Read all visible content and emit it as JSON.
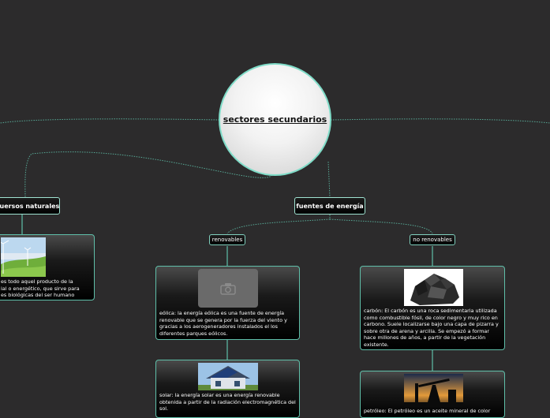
{
  "central_topic": "sectores secundarios",
  "topics": {
    "recursos": "cuersos naturales",
    "energia": "fuentes de energía"
  },
  "subtopics": {
    "renovables": "renovables",
    "no_renovables": "no renovables"
  },
  "cards": {
    "recursos_text": "es todo aquel producto de la\nial o energético, que sirve para\nes biológicas del ser humano",
    "eolica": "eólica: la energía eólica es una fuente de energía renovable que se genera por la fuerza del viento y gracias a los aerogeneradores instalados el los diferentes parques eólicos.",
    "solar": "solar: la energía solar es una energía renovable obtenida a partir de la radiación electromagnética del sol.",
    "carbon": "carbón: El carbón es una roca sedimentaria utilizada como combustible fósil, de color negro y muy rico en carbono. Suele localizarse bajo una capa de pizarra y sobre otra de arena y arcilla. Se empezó a formar hace millones de años, a partir de la vegetación existente.",
    "petroleo": "petróleo: El petróleo es un aceite mineral de color"
  },
  "icons": {
    "image_placeholder": "camera-icon"
  },
  "colors": {
    "background": "#2c2b2c",
    "connector": "#5fbfa9",
    "node_border": "#9fe3d2"
  }
}
